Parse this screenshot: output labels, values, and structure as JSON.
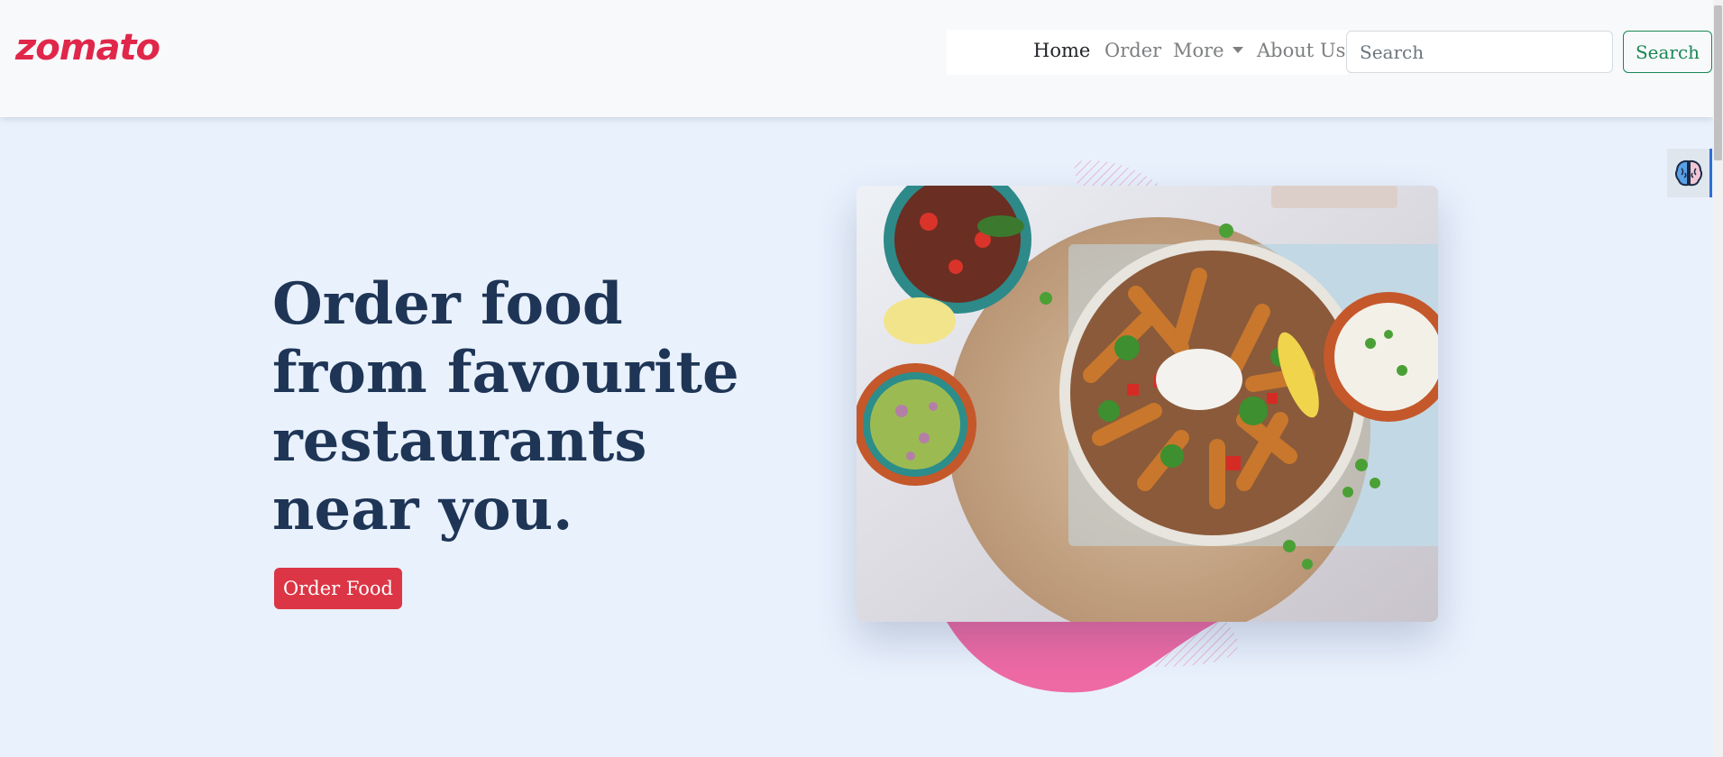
{
  "navbar": {
    "brand": "zomato",
    "links": [
      {
        "label": "Home"
      },
      {
        "label": "Order"
      },
      {
        "label": "More"
      },
      {
        "label": "About Us"
      }
    ],
    "search": {
      "placeholder": "Search",
      "value": "",
      "button_label": "Search"
    }
  },
  "hero": {
    "title": "Order food from favourite restaurants near you.",
    "cta_label": "Order Food"
  },
  "colors": {
    "brand": "#e0274a",
    "heading": "#1e3556",
    "cta": "#dc3545",
    "search_button": "#198754",
    "page_background": "#e9f1fd",
    "blob": "#ee6aa5"
  },
  "icons": {
    "dropdown": "caret-down-icon",
    "widget": "brain-icon"
  }
}
